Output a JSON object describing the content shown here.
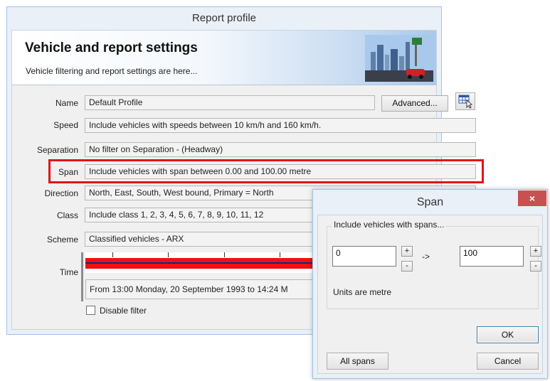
{
  "window": {
    "title": "Report profile",
    "banner_title": "Vehicle and report settings",
    "banner_subtitle": "Vehicle filtering and report settings are here..."
  },
  "fields": {
    "name": {
      "label": "Name",
      "value": "Default Profile"
    },
    "speed": {
      "label": "Speed",
      "value": "Include vehicles with speeds between 10 km/h and 160 km/h."
    },
    "separation": {
      "label": "Separation",
      "value": "No filter on Separation - (Headway)"
    },
    "span": {
      "label": "Span",
      "value": "Include vehicles with span between 0.00 and 100.00 metre"
    },
    "direction": {
      "label": "Direction",
      "value": "North, East, South, West bound, Primary = North"
    },
    "class": {
      "label": "Class",
      "value": "Include class  1, 2, 3, 4, 5, 6, 7, 8, 9, 10, 11, 12"
    },
    "scheme": {
      "label": "Scheme",
      "value": "Classified vehicles - ARX"
    },
    "time": {
      "label": "Time",
      "value": "From 13:00 Monday, 20 September 1993 to 14:24 M"
    }
  },
  "buttons": {
    "advanced": "Advanced...",
    "picker_icon": "table-cursor-icon"
  },
  "disable_filter": {
    "label": "Disable filter",
    "checked": false
  },
  "span_dialog": {
    "title": "Span",
    "close_glyph": "×",
    "group_label": "Include vehicles with spans...",
    "min_value": "0",
    "max_value": "100",
    "arrow": "->",
    "plus": "+",
    "minus": "-",
    "units": "Units are metre",
    "ok": "OK",
    "all_spans": "All spans",
    "cancel": "Cancel"
  },
  "colors": {
    "highlight": "#e0141a",
    "timebar_fill": "#f01010",
    "timebar_line": "#0a2a8c",
    "close_button": "#c75050"
  }
}
